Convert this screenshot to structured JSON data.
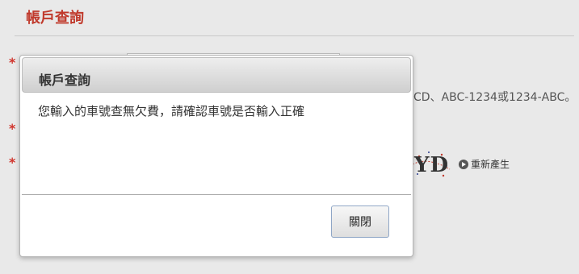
{
  "page": {
    "title": "帳戶查詢",
    "required_marker": "*"
  },
  "form": {
    "hint_text": "CD、ABC-1234或1234-ABC。",
    "captcha_text": "YD",
    "regenerate_label": "重新產生"
  },
  "dialog": {
    "title": "帳戶查詢",
    "message": "您輸入的車號查無欠費，請確認車號是否輸入正確",
    "close_label": "關閉"
  },
  "colors": {
    "title_red": "#c0392b",
    "required_red": "#d0342c",
    "button_border": "#8fa6c6"
  },
  "icons": {
    "regenerate": "play-circle-icon"
  }
}
